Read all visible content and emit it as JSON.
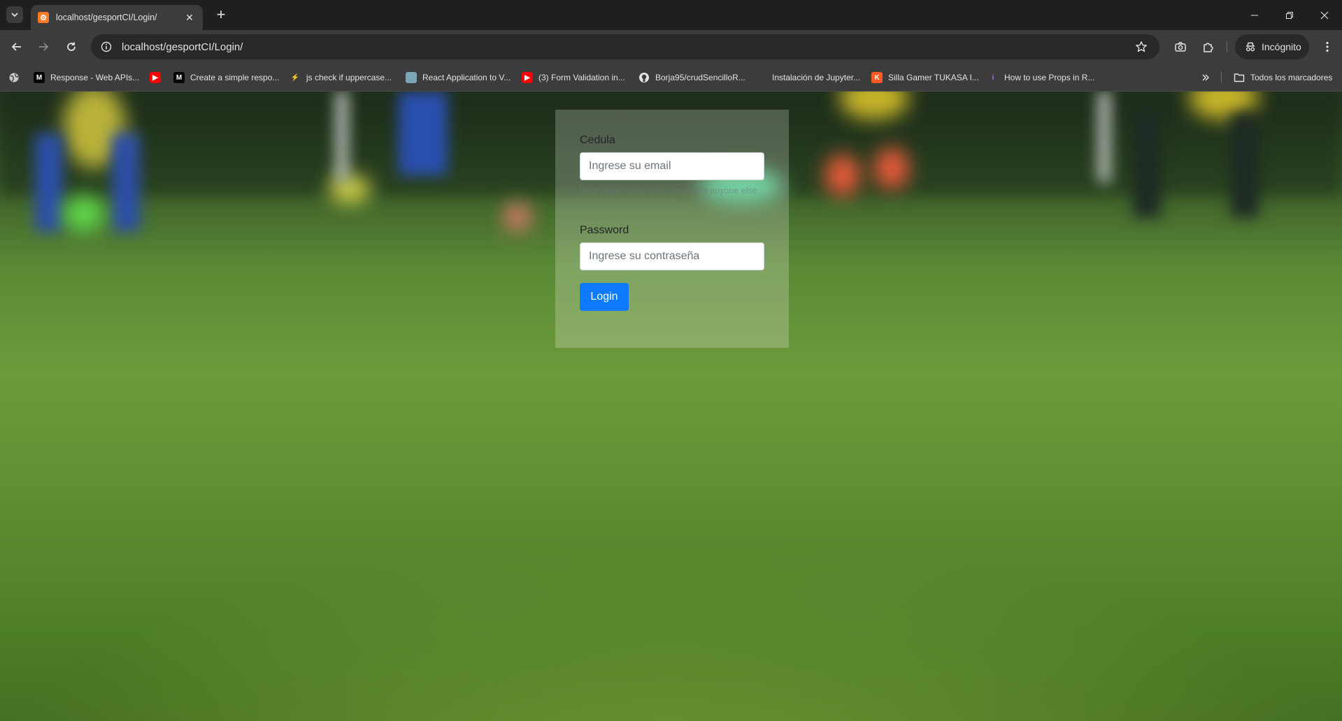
{
  "browser": {
    "tab": {
      "title": "localhost/gesportCI/Login/"
    },
    "url": "localhost/gesportCI/Login/",
    "incognito_label": "Incógnito",
    "bookmarks": [
      {
        "label": "Response - Web APIs...",
        "icon": "medium-icon"
      },
      {
        "label": "",
        "icon": "youtube-icon"
      },
      {
        "label": "Create a simple respo...",
        "icon": "medium-icon"
      },
      {
        "label": "js check if uppercase...",
        "icon": "lightning-icon"
      },
      {
        "label": "React Application to V...",
        "icon": "page-icon"
      },
      {
        "label": "(3) Form Validation in...",
        "icon": "youtube-icon"
      },
      {
        "label": "Borja95/crudSencilloR...",
        "icon": "github-icon"
      },
      {
        "label": "Instalación de Jupyter...",
        "icon": "blank-icon"
      },
      {
        "label": "Silla Gamer TUKASA I...",
        "icon": "k-icon"
      },
      {
        "label": "How to use Props in R...",
        "icon": "info-icon"
      }
    ],
    "all_bookmarks_label": "Todos los marcadores"
  },
  "login": {
    "cedula_label": "Cedula",
    "email_placeholder": "Ingrese su email",
    "email_help": "We'll never share your email with anyone else.",
    "password_label": "Password",
    "password_placeholder": "Ingrese su contraseña",
    "login_button": "Login"
  },
  "colors": {
    "button_primary": "#0d7bff",
    "chrome_dark": "#1f1f1f",
    "chrome_toolbar": "#3c3c3c"
  }
}
